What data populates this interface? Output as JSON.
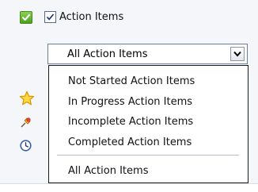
{
  "filter": {
    "checkbox_label": "Action Items",
    "checked": true
  },
  "select": {
    "value": "All Action Items"
  },
  "dropdown": {
    "options": [
      "Not Started Action Items",
      "In Progress Action Items",
      "Incomplete Action Items",
      "Completed Action Items",
      "All Action Items"
    ]
  },
  "icons": {
    "header": "green-check-icon",
    "left": [
      "star-icon",
      "pushpin-icon",
      "clock-icon"
    ]
  },
  "colors": {
    "panel_bg": "#f4f6f9",
    "check_green": "#4aa01c",
    "star": "#f5b400",
    "clock": "#3a5fb0"
  }
}
